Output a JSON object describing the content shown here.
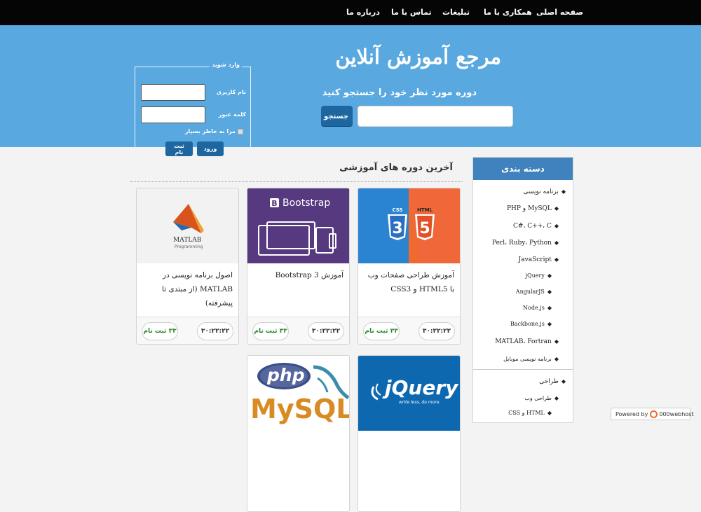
{
  "nav": {
    "items": [
      "صفحه اصلی",
      "همکاری با ما",
      "تبلیغات",
      "تماس با ما",
      "درباره ما"
    ]
  },
  "hero": {
    "title": "مرجع آموزش آنلاین",
    "subtitle": "دوره مورد نظر خود را جستجو کنید",
    "search_placeholder": "",
    "search_button": "جستجو"
  },
  "login": {
    "legend": "وارد شوید",
    "username_label": "نام کاربری",
    "password_label": "کلمه عبور",
    "remember_label": "مرا به خاطر بسپار",
    "login_button": "ورود",
    "register_button": "ثبت نام"
  },
  "sidebar": {
    "title": "دسته بندی",
    "items": [
      {
        "label": "برنامه نویسی",
        "level": 0
      },
      {
        "label": "MySQL و PHP",
        "level": 1
      },
      {
        "label": "C#، C++، C",
        "level": 1
      },
      {
        "label": "Perl، Ruby، Python",
        "level": 1
      },
      {
        "label": "JavaScript",
        "level": 1
      },
      {
        "label": "jQuery",
        "level": 2
      },
      {
        "label": "AngularJS",
        "level": 2
      },
      {
        "label": "Node.js",
        "level": 2
      },
      {
        "label": "Backbone.js",
        "level": 2
      },
      {
        "label": "MATLAB، Fortran",
        "level": 1
      },
      {
        "label": "برنامه نویسی موبایل",
        "level": 1
      },
      {
        "label": "طراحی",
        "level": 0
      },
      {
        "label": "طراحی وب",
        "level": 1
      },
      {
        "label": "HTML و CSS",
        "level": 2
      }
    ]
  },
  "courses": {
    "section_title": "آخرین دوره های آموزشی",
    "items": [
      {
        "title": "آموزش طراحی صفحات وب با HTML5 و CSS3",
        "duration": "۳۰:۲۲:۲۲",
        "enrolled": "۳۳ ثبت نام",
        "thumb": "html5-css3-logo"
      },
      {
        "title": "آموزش Bootstrap 3",
        "duration": "۳۰:۲۲:۲۲",
        "enrolled": "۳۳ ثبت نام",
        "thumb": "bootstrap-logo",
        "thumb_text": "Bootstrap"
      },
      {
        "title": "اصول برنامه نویسی در MATLAB (از مبتدی تا پیشرفته)",
        "duration": "۳۰:۲۲:۲۲",
        "enrolled": "۳۳ ثبت نام",
        "thumb": "matlab-logo",
        "thumb_text": "MATLAB",
        "thumb_sub": "Programming"
      },
      {
        "thumb": "jquery-logo",
        "thumb_text": "jQuery",
        "thumb_sub": "write less, do more."
      },
      {
        "thumb": "php-mysql-logo",
        "thumb_text": "php",
        "thumb_sub": "MySQL"
      }
    ]
  },
  "footer": {
    "powered_by": "Powered by",
    "host": "000webhost"
  }
}
